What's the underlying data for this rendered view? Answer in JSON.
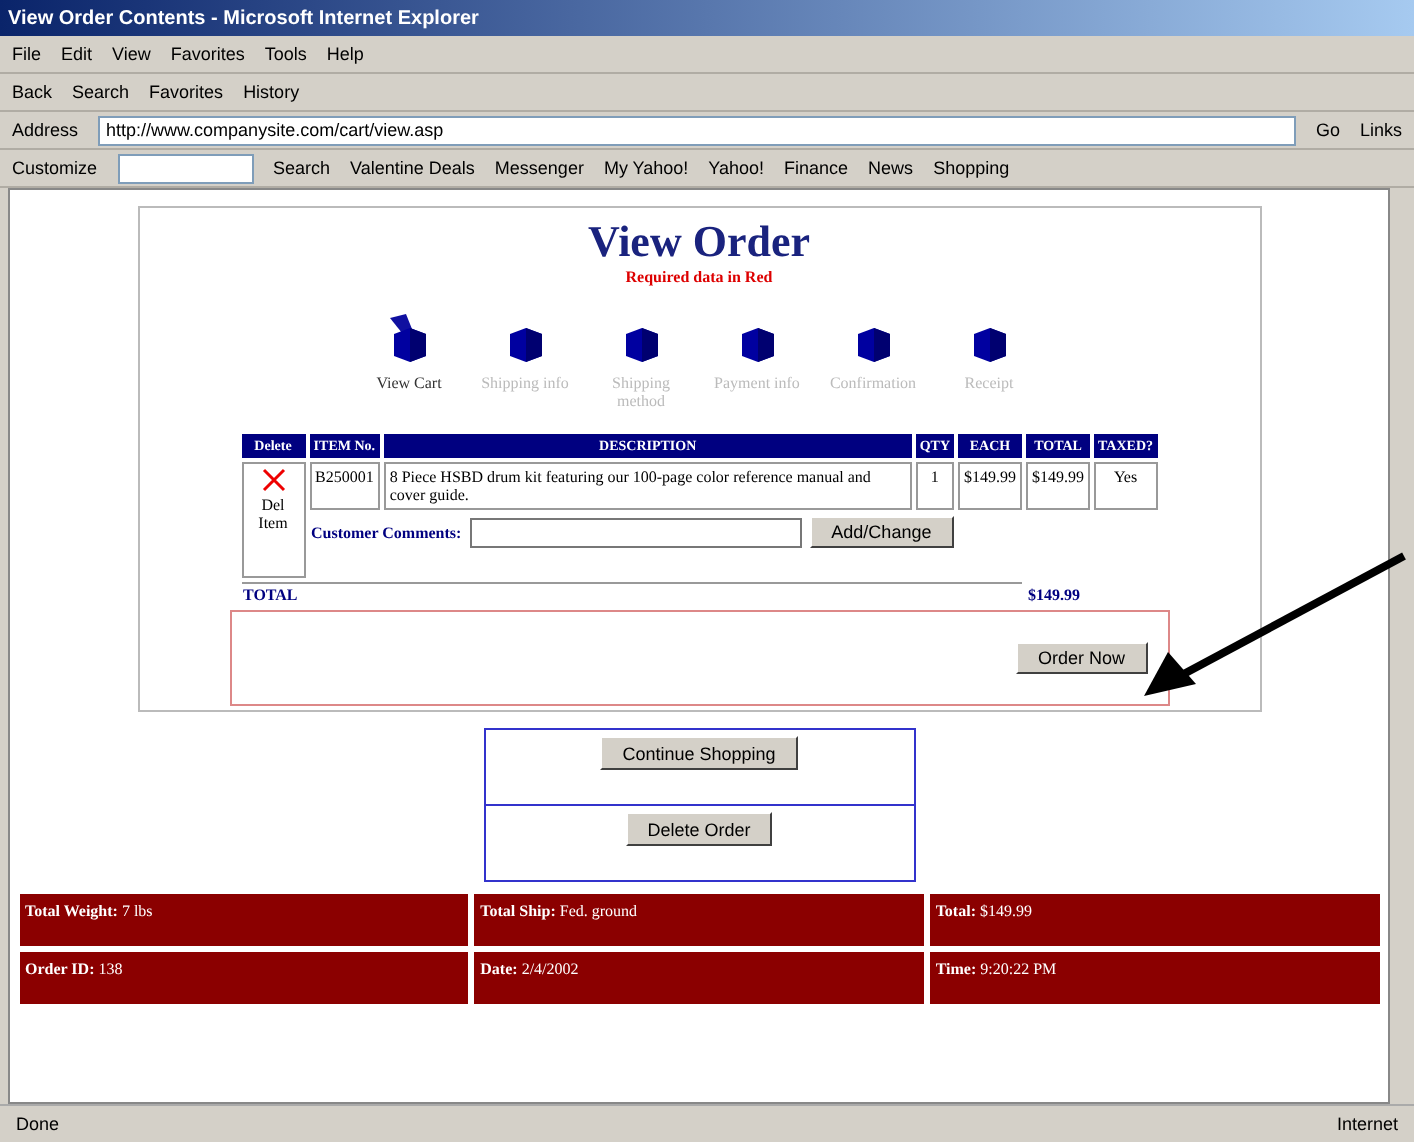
{
  "window": {
    "title": "View Order Contents - Microsoft Internet Explorer"
  },
  "menu": [
    "File",
    "Edit",
    "View",
    "Favorites",
    "Tools",
    "Help"
  ],
  "toolbar": [
    "Back",
    "Search",
    "Favorites",
    "History"
  ],
  "address": {
    "label": "Address",
    "value": "http://www.companysite.com/cart/view.asp",
    "go": "Go",
    "links": "Links"
  },
  "yahoo_bar": {
    "customize": "Customize",
    "search": "Search",
    "items": [
      "Valentine Deals",
      "Messenger",
      "My Yahoo!",
      "Yahoo!",
      "Finance",
      "News",
      "Shopping"
    ]
  },
  "page": {
    "title": "View Order",
    "subtitle": "Required data in Red",
    "steps": [
      {
        "label": "View Cart",
        "selected": true
      },
      {
        "label": "Shipping info",
        "selected": false
      },
      {
        "label": "Shipping method",
        "selected": false
      },
      {
        "label": "Payment info",
        "selected": false
      },
      {
        "label": "Confirmation",
        "selected": false
      },
      {
        "label": "Receipt",
        "selected": false
      }
    ],
    "table": {
      "columns": [
        "Delete",
        "ITEM No.",
        "DESCRIPTION",
        "QTY",
        "EACH",
        "TOTAL",
        "TAXED?"
      ],
      "rows": [
        {
          "delete": "Del Item",
          "item": "B250001",
          "description": "8 Piece HSBD drum kit featuring our 100-page color reference manual and cover guide.",
          "qty": "1",
          "each": "$149.99",
          "total": "$149.99",
          "taxed": "Yes"
        }
      ],
      "comments_label": "Customer Comments:",
      "comments_button": "Add/Change",
      "total_label": "TOTAL",
      "total_value": "$149.99"
    },
    "order_button": "Order Now",
    "buttons": [
      "Continue Shopping",
      "Delete Order"
    ],
    "summary": [
      [
        {
          "label": "Total Weight:",
          "value": "7 lbs"
        },
        {
          "label": "Total Ship:",
          "value": "Fed. ground"
        },
        {
          "label": "Total:",
          "value": "$149.99"
        }
      ],
      [
        {
          "label": "Order ID:",
          "value": "138"
        },
        {
          "label": "Date:",
          "value": "2/4/2002"
        },
        {
          "label": "Time:",
          "value": "9:20:22 PM"
        }
      ]
    ]
  },
  "status_bar": {
    "text": "Done",
    "zone": "Internet"
  }
}
